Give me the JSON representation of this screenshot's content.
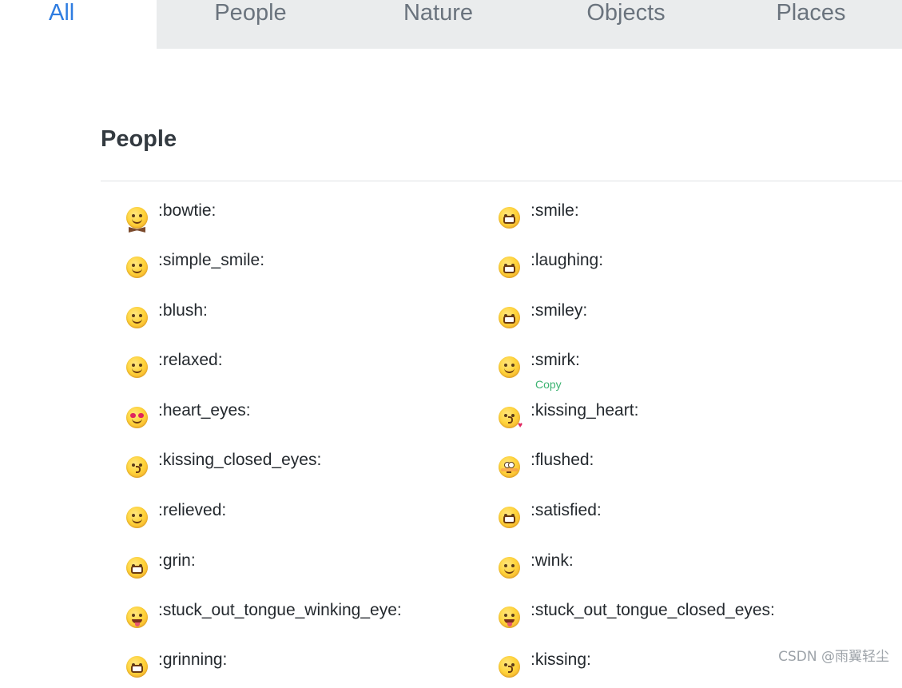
{
  "tabs": [
    "All",
    "People",
    "Nature",
    "Objects",
    "Places"
  ],
  "section_title": "People",
  "left_items": [
    {
      "label": ":bowtie:",
      "icon": "bowtie-emoji-icon"
    },
    {
      "label": ":simple_smile:",
      "icon": "simple-smile-emoji-icon"
    },
    {
      "label": ":blush:",
      "icon": "blush-emoji-icon"
    },
    {
      "label": ":relaxed:",
      "icon": "relaxed-emoji-icon"
    },
    {
      "label": ":heart_eyes:",
      "icon": "heart-eyes-emoji-icon"
    },
    {
      "label": ":kissing_closed_eyes:",
      "icon": "kissing-closed-eyes-emoji-icon"
    },
    {
      "label": ":relieved:",
      "icon": "relieved-emoji-icon"
    },
    {
      "label": ":grin:",
      "icon": "grin-emoji-icon"
    },
    {
      "label": ":stuck_out_tongue_winking_eye:",
      "icon": "stuck-out-tongue-winking-eye-emoji-icon"
    },
    {
      "label": ":grinning:",
      "icon": "grinning-emoji-icon"
    }
  ],
  "right_items": [
    {
      "label": ":smile:",
      "icon": "smile-emoji-icon"
    },
    {
      "label": ":laughing:",
      "icon": "laughing-emoji-icon"
    },
    {
      "label": ":smiley:",
      "icon": "smiley-emoji-icon"
    },
    {
      "label": ":smirk:",
      "icon": "smirk-emoji-icon"
    },
    {
      "label": ":kissing_heart:",
      "icon": "kissing-heart-emoji-icon"
    },
    {
      "label": ":flushed:",
      "icon": "flushed-emoji-icon"
    },
    {
      "label": ":satisfied:",
      "icon": "satisfied-emoji-icon"
    },
    {
      "label": ":wink:",
      "icon": "wink-emoji-icon"
    },
    {
      "label": ":stuck_out_tongue_closed_eyes:",
      "icon": "stuck-out-tongue-closed-eyes-emoji-icon"
    },
    {
      "label": ":kissing:",
      "icon": "kissing-emoji-icon"
    }
  ],
  "copy_label": "Copy",
  "watermark": "CSDN @雨翼轻尘",
  "colors": {
    "active_tab": "#2f7de1",
    "tab_bg": "#eaeced",
    "copy": "#3cb371"
  }
}
